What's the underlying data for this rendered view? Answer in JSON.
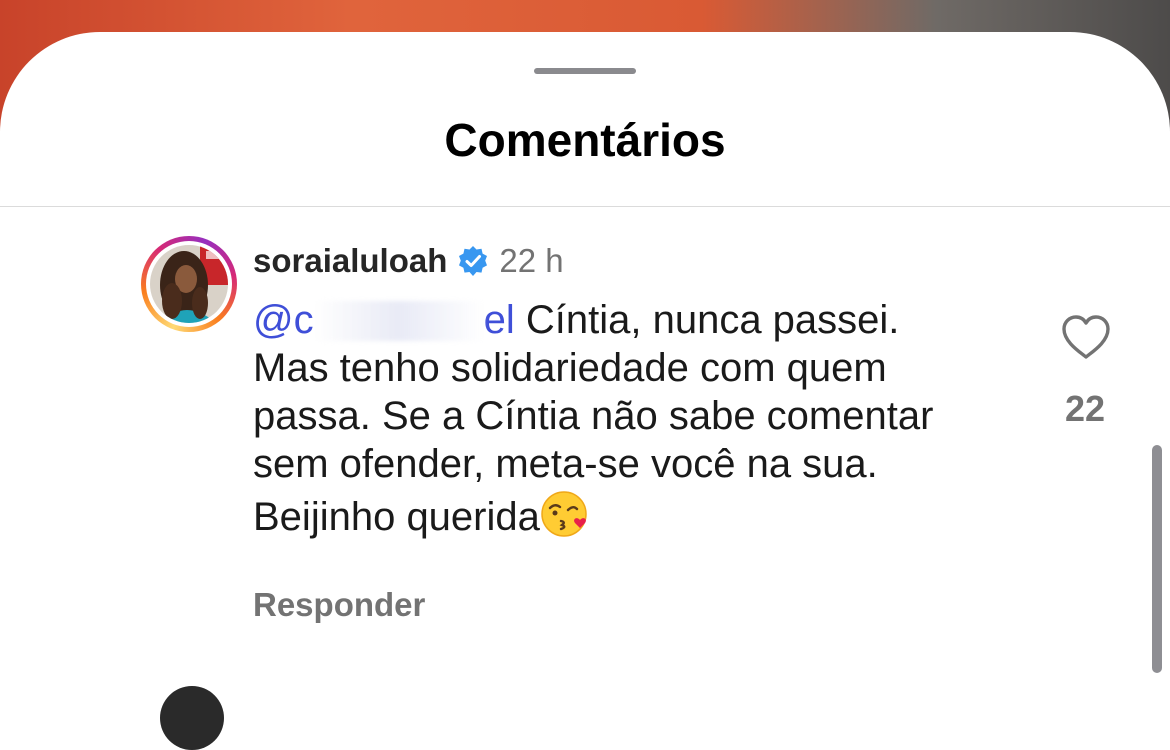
{
  "sheet": {
    "title": "Comentários"
  },
  "comment": {
    "username": "soraialuloah",
    "verified": true,
    "time": "22 h",
    "mention_visible_start": "@c",
    "mention_visible_end": "el",
    "text_line1": " Cíntia, nunca passei.",
    "text_rest": "Mas tenho solidariedade com quem passa. Se a Cíntia não sabe comentar sem ofender, meta-se você na sua. Beijinho querida",
    "emoji": "face-blowing-a-kiss",
    "reply_label": "Responder",
    "like_count": "22"
  },
  "colors": {
    "mention": "#3f4fd8",
    "secondary_text": "#737373",
    "verified_badge": "#3897f0"
  },
  "icons": {
    "like": "heart-outline-icon",
    "verified": "verified-badge-icon"
  }
}
